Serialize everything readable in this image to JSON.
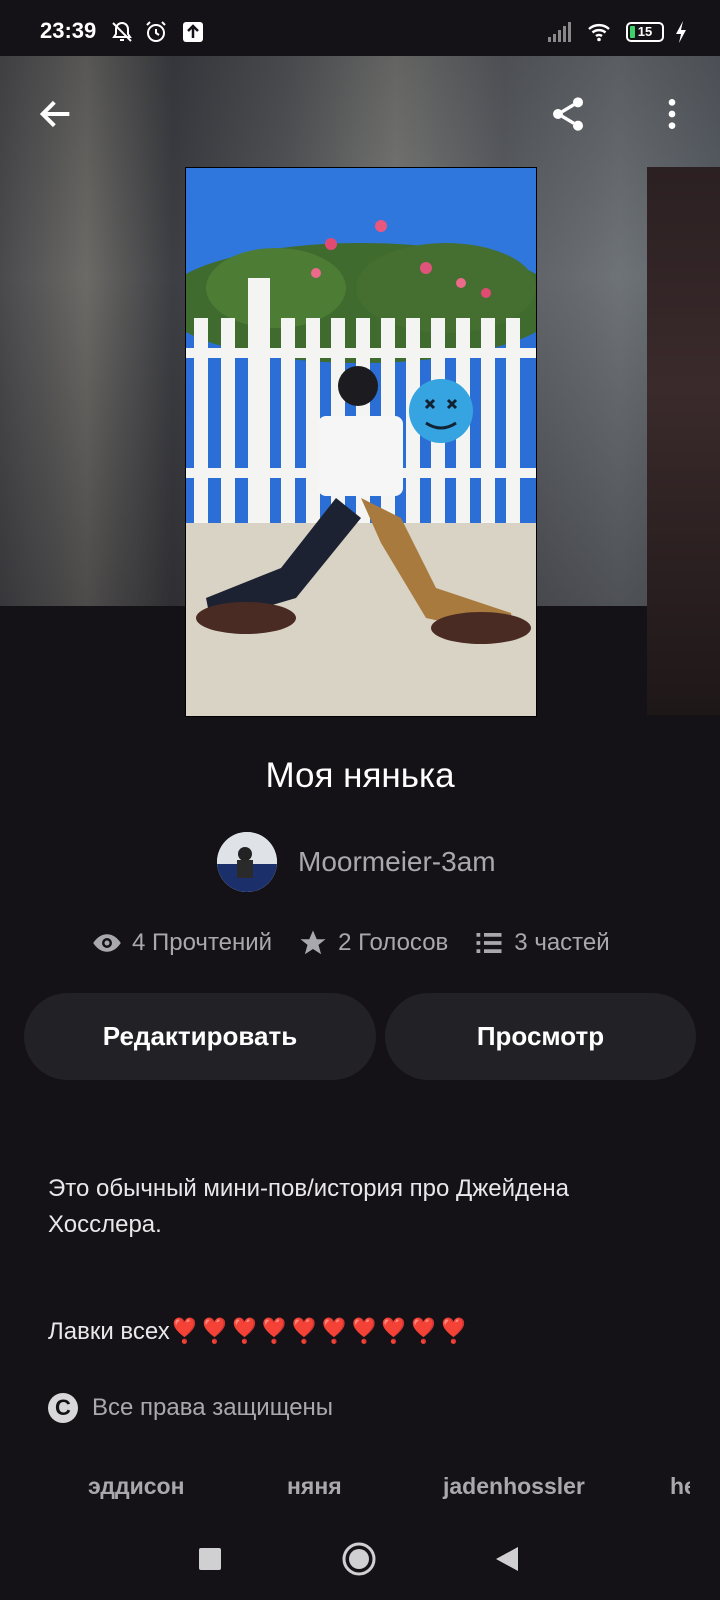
{
  "status_bar": {
    "time": "23:39",
    "battery": "15",
    "icons": [
      "bell-off-icon",
      "alarm-icon",
      "upload-icon",
      "signal-icon",
      "wifi-icon",
      "battery-icon",
      "charging-icon"
    ]
  },
  "header": {
    "back_icon": "arrow-left-icon",
    "share_icon": "share-icon",
    "more_icon": "more-vertical-icon"
  },
  "story": {
    "title": "Моя нянька",
    "author": "Moormeier-3am",
    "stats": {
      "reads": "4 Прочтений",
      "votes": "2 Голосов",
      "parts": "3 частей"
    },
    "actions": {
      "edit": "Редактировать",
      "preview": "Просмотр"
    },
    "description_1": "Это обычный мини-пов/история про Джейдена Хосслера.",
    "description_2": "Лавки всех❣️❣️❣️❣️❣️❣️❣️❣️❣️❣️",
    "copyright": "Все права защищены",
    "copyright_symbol": "C",
    "tags": [
      "эддисон",
      "няня",
      "jadenhossler",
      "he"
    ]
  },
  "colors": {
    "background": "#141216",
    "button_bg": "#222125",
    "muted_text": "#a9a9ad"
  }
}
